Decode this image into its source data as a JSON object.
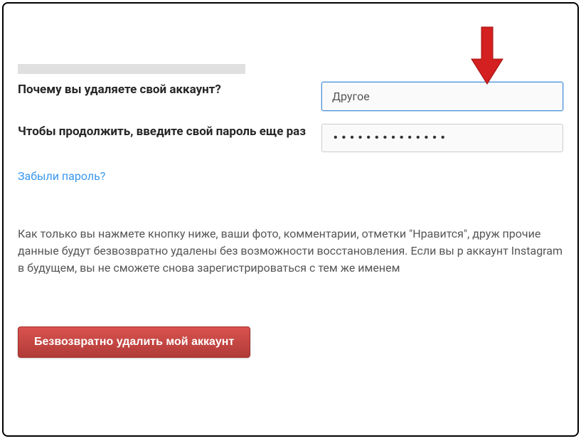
{
  "form": {
    "reason_label": "Почему вы удаляете свой аккаунт?",
    "reason_value": "Другое",
    "password_label": "Чтобы продолжить, введите свой пароль еще раз",
    "password_value": "••••••••••••••",
    "forgot_password": "Забыли пароль?"
  },
  "warning": "Как только вы нажмете кнопку ниже, ваши фото, комментарии, отметки \"Нравится\", друж прочие данные будут безвозвратно удалены без возможности восстановления. Если вы р аккаунт Instagram в будущем, вы не сможете снова зарегистрироваться с тем же именем",
  "delete_button": "Безвозвратно удалить мой аккаунт",
  "annotation": {
    "arrow_color": "#d42020"
  }
}
